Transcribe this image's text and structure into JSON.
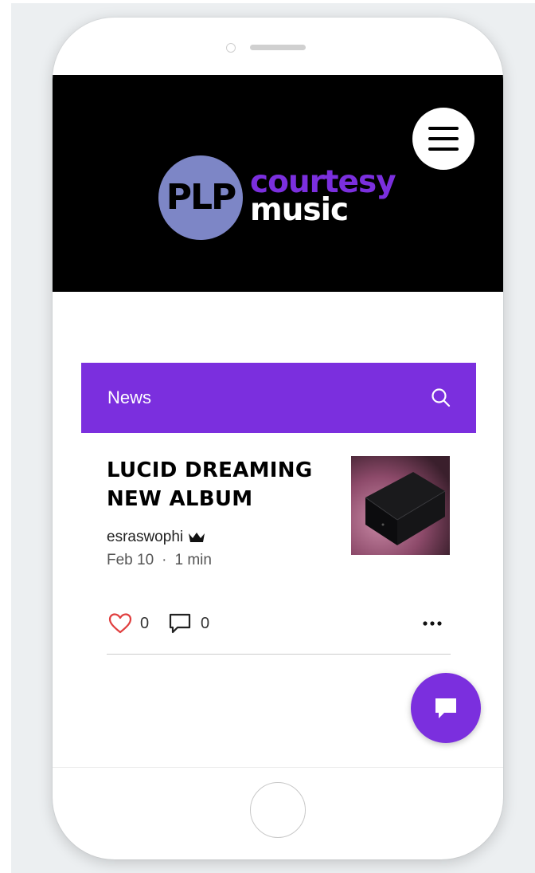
{
  "brand": {
    "logo_monogram": "PLP",
    "logo_line1": "courtesy",
    "logo_line2": "music",
    "accent_color": "#7b2fde",
    "logo_circle_color": "#7d86c6"
  },
  "header": {
    "menu_icon": "hamburger-menu-icon"
  },
  "blog_bar": {
    "label": "News",
    "search_icon": "search-icon"
  },
  "post": {
    "title_line1": "LUCID DREAMING",
    "title_line2": "NEW ALBUM",
    "author": "esraswophi",
    "author_badge_icon": "crown-icon",
    "date": "Feb 10",
    "separator": "·",
    "read_time": "1 min",
    "likes": "0",
    "comments": "0",
    "like_icon": "heart-icon",
    "comment_icon": "comment-icon",
    "more_icon": "more-options-icon"
  },
  "chat": {
    "icon": "chat-bubble-icon"
  }
}
